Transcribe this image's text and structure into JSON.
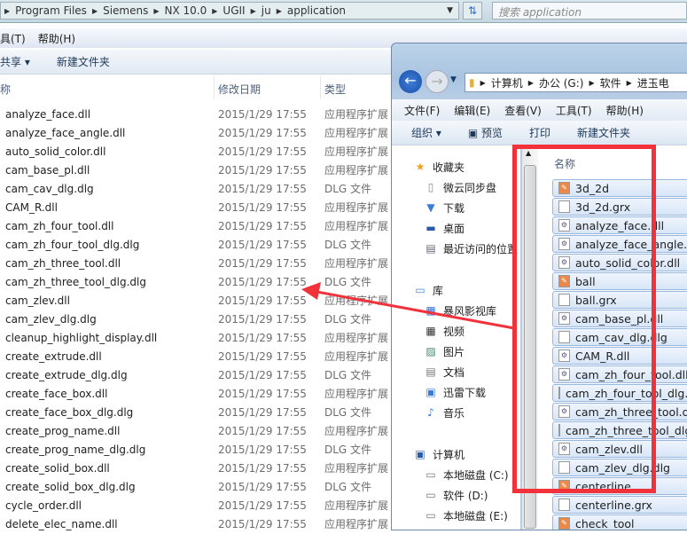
{
  "back_window": {
    "address": [
      "Program Files",
      "Siemens",
      "NX 10.0",
      "UGII",
      "ju",
      "application"
    ],
    "search_placeholder": "搜索 application",
    "menu": [
      "具(T)",
      "帮助(H)"
    ],
    "toolbar": {
      "share": "共享",
      "new_folder": "新建文件夹"
    },
    "columns": [
      "称",
      "修改日期",
      "类型"
    ],
    "rows": [
      [
        "analyze_face.dll",
        "2015/1/29 17:55",
        "应用程序扩展"
      ],
      [
        "analyze_face_angle.dll",
        "2015/1/29 17:55",
        "应用程序扩展"
      ],
      [
        "auto_solid_color.dll",
        "2015/1/29 17:55",
        "应用程序扩展"
      ],
      [
        "cam_base_pl.dll",
        "2015/1/29 17:55",
        "应用程序扩展"
      ],
      [
        "cam_cav_dlg.dlg",
        "2015/1/29 17:55",
        "DLG 文件"
      ],
      [
        "CAM_R.dll",
        "2015/1/29 17:55",
        "应用程序扩展"
      ],
      [
        "cam_zh_four_tool.dll",
        "2015/1/29 17:55",
        "应用程序扩展"
      ],
      [
        "cam_zh_four_tool_dlg.dlg",
        "2015/1/29 17:55",
        "DLG 文件"
      ],
      [
        "cam_zh_three_tool.dll",
        "2015/1/29 17:55",
        "应用程序扩展"
      ],
      [
        "cam_zh_three_tool_dlg.dlg",
        "2015/1/29 17:55",
        "DLG 文件"
      ],
      [
        "cam_zlev.dll",
        "2015/1/29 17:55",
        "应用程序扩展"
      ],
      [
        "cam_zlev_dlg.dlg",
        "2015/1/29 17:55",
        "DLG 文件"
      ],
      [
        "cleanup_highlight_display.dll",
        "2015/1/29 17:55",
        "应用程序扩展"
      ],
      [
        "create_extrude.dll",
        "2015/1/29 17:55",
        "应用程序扩展"
      ],
      [
        "create_extrude_dlg.dlg",
        "2015/1/29 17:55",
        "DLG 文件"
      ],
      [
        "create_face_box.dll",
        "2015/1/29 17:55",
        "应用程序扩展"
      ],
      [
        "create_face_box_dlg.dlg",
        "2015/1/29 17:55",
        "DLG 文件"
      ],
      [
        "create_prog_name.dll",
        "2015/1/29 17:55",
        "应用程序扩展"
      ],
      [
        "create_prog_name_dlg.dlg",
        "2015/1/29 17:55",
        "DLG 文件"
      ],
      [
        "create_solid_box.dll",
        "2015/1/29 17:55",
        "应用程序扩展"
      ],
      [
        "create_solid_box_dlg.dlg",
        "2015/1/29 17:55",
        "DLG 文件"
      ],
      [
        "cycle_order.dll",
        "2015/1/29 17:55",
        "应用程序扩展"
      ],
      [
        "delete_elec_name.dll",
        "2015/1/29 17:55",
        "应用程序扩展"
      ]
    ]
  },
  "front_window": {
    "address": [
      "计算机",
      "办公 (G:)",
      "软件",
      "进玉电"
    ],
    "menu": [
      "文件(F)",
      "编辑(E)",
      "查看(V)",
      "工具(T)",
      "帮助(H)"
    ],
    "toolbar": [
      "组织",
      "预览",
      "打印",
      "新建文件夹"
    ],
    "sidebar": [
      {
        "label": "收藏夹",
        "icon": "star-icon",
        "level": 0
      },
      {
        "label": "微云同步盘",
        "icon": "file-icon",
        "level": 1
      },
      {
        "label": "下载",
        "icon": "download-folder-icon",
        "level": 1
      },
      {
        "label": "桌面",
        "icon": "desktop-icon",
        "level": 1
      },
      {
        "label": "最近访问的位置",
        "icon": "recent-icon",
        "level": 1
      },
      {
        "label": "库",
        "icon": "library-icon",
        "level": 0
      },
      {
        "label": "暴风影视库",
        "icon": "video-library-icon",
        "level": 1
      },
      {
        "label": "视频",
        "icon": "video-icon",
        "level": 1
      },
      {
        "label": "图片",
        "icon": "picture-icon",
        "level": 1
      },
      {
        "label": "文档",
        "icon": "document-icon",
        "level": 1
      },
      {
        "label": "迅雷下载",
        "icon": "thunder-icon",
        "level": 1
      },
      {
        "label": "音乐",
        "icon": "music-icon",
        "level": 1
      },
      {
        "label": "计算机",
        "icon": "computer-icon",
        "level": 0
      },
      {
        "label": "本地磁盘 (C:)",
        "icon": "drive-icon",
        "level": 1
      },
      {
        "label": "软件 (D:)",
        "icon": "drive-icon",
        "level": 1
      },
      {
        "label": "本地磁盘 (E:)",
        "icon": "drive-icon",
        "level": 1
      }
    ],
    "column": "名称",
    "files": [
      {
        "name": "3d_2d",
        "icon": "grx-app-icon"
      },
      {
        "name": "3d_2d.grx",
        "icon": "blank-file-icon"
      },
      {
        "name": "analyze_face.dll",
        "icon": "dll-icon"
      },
      {
        "name": "analyze_face_angle.dll",
        "icon": "dll-icon"
      },
      {
        "name": "auto_solid_color.dll",
        "icon": "dll-icon"
      },
      {
        "name": "ball",
        "icon": "grx-app-icon"
      },
      {
        "name": "ball.grx",
        "icon": "blank-file-icon"
      },
      {
        "name": "cam_base_pl.dll",
        "icon": "dll-icon"
      },
      {
        "name": "cam_cav_dlg.dlg",
        "icon": "blank-file-icon"
      },
      {
        "name": "CAM_R.dll",
        "icon": "dll-icon"
      },
      {
        "name": "cam_zh_four_tool.dll",
        "icon": "dll-icon"
      },
      {
        "name": "cam_zh_four_tool_dlg.dlg",
        "icon": "blank-file-icon"
      },
      {
        "name": "cam_zh_three_tool.dll",
        "icon": "dll-icon"
      },
      {
        "name": "cam_zh_three_tool_dlg.dlg",
        "icon": "blank-file-icon"
      },
      {
        "name": "cam_zlev.dll",
        "icon": "dll-icon"
      },
      {
        "name": "cam_zlev_dlg.dlg",
        "icon": "blank-file-icon"
      },
      {
        "name": "centerline",
        "icon": "grx-app-icon"
      },
      {
        "name": "centerline.grx",
        "icon": "blank-file-icon"
      },
      {
        "name": "check_tool",
        "icon": "grx-app-icon"
      }
    ]
  },
  "colors": {
    "annotation": "#f2323a",
    "selection": "#d8e6f8"
  }
}
